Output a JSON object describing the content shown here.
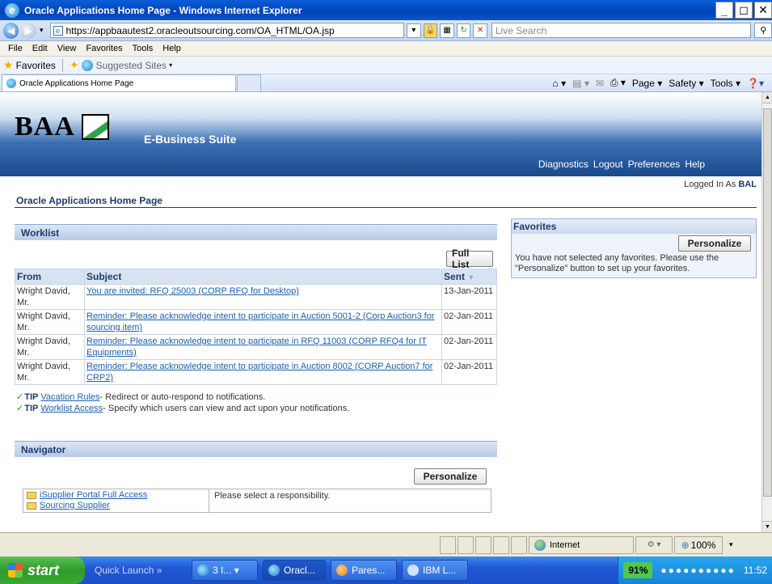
{
  "window": {
    "title": "Oracle Applications Home Page - Windows Internet Explorer"
  },
  "browser": {
    "address": "https://appbaautest2.oracleoutsourcing.com/OA_HTML/OA.jsp",
    "search_placeholder": "Live Search",
    "menu": [
      "File",
      "Edit",
      "View",
      "Favorites",
      "Tools",
      "Help"
    ],
    "favorites_label": "Favorites",
    "suggested_sites": "Suggested Sites",
    "tab_title": "Oracle Applications Home Page",
    "commands": [
      "Page",
      "Safety",
      "Tools"
    ]
  },
  "app": {
    "logo_text": "BAA",
    "suite_title": "E-Business Suite",
    "global_links": [
      "Diagnostics",
      "Logout",
      "Preferences",
      "Help"
    ],
    "logged_in_label": "Logged In As",
    "logged_in_user": "BAL",
    "page_title": "Oracle Applications Home Page"
  },
  "worklist": {
    "header": "Worklist",
    "full_list_button": "Full List",
    "columns": {
      "from": "From",
      "subject": "Subject",
      "sent": "Sent"
    },
    "rows": [
      {
        "from": "Wright David, Mr.",
        "subject": "You are invited: RFQ 25003 (CORP RFQ for Desktop)",
        "sent": "13-Jan-2011"
      },
      {
        "from": "Wright David, Mr.",
        "subject": "Reminder: Please acknowledge intent to participate in Auction 5001-2 (Corp Auction3 for sourcing item)",
        "sent": "02-Jan-2011"
      },
      {
        "from": "Wright David, Mr.",
        "subject": "Reminder: Please acknowledge intent to participate in RFQ 11003 (CORP RFQ4 for IT Equipments)",
        "sent": "02-Jan-2011"
      },
      {
        "from": "Wright David, Mr.",
        "subject": "Reminder: Please acknowledge intent to participate in Auction 8002 (CORP Auction7 for CRP2)",
        "sent": "02-Jan-2011"
      }
    ],
    "tips": [
      {
        "label": "TIP",
        "link": "Vacation Rules",
        "text": " - Redirect or auto-respond to notifications."
      },
      {
        "label": "TIP",
        "link": "Worklist Access",
        "text": " - Specify which users can view and act upon your notifications."
      }
    ]
  },
  "navigator": {
    "header": "Navigator",
    "personalize_button": "Personalize",
    "responsibilities": [
      "iSupplier Portal Full Access",
      "Sourcing Supplier"
    ],
    "message": "Please select a responsibility."
  },
  "favorites": {
    "header": "Favorites",
    "personalize_button": "Personalize",
    "message": "You have not selected any favorites. Please use the \"Personalize\" button to set up your favorites."
  },
  "statusbar": {
    "zone": "Internet",
    "zoom": "100%"
  },
  "taskbar": {
    "start": "start",
    "quick_launch": "Quick Launch",
    "items": [
      "3 I...",
      "Oracl...",
      "Pares...",
      "IBM L..."
    ],
    "battery": "91%",
    "clock": "11:52"
  }
}
